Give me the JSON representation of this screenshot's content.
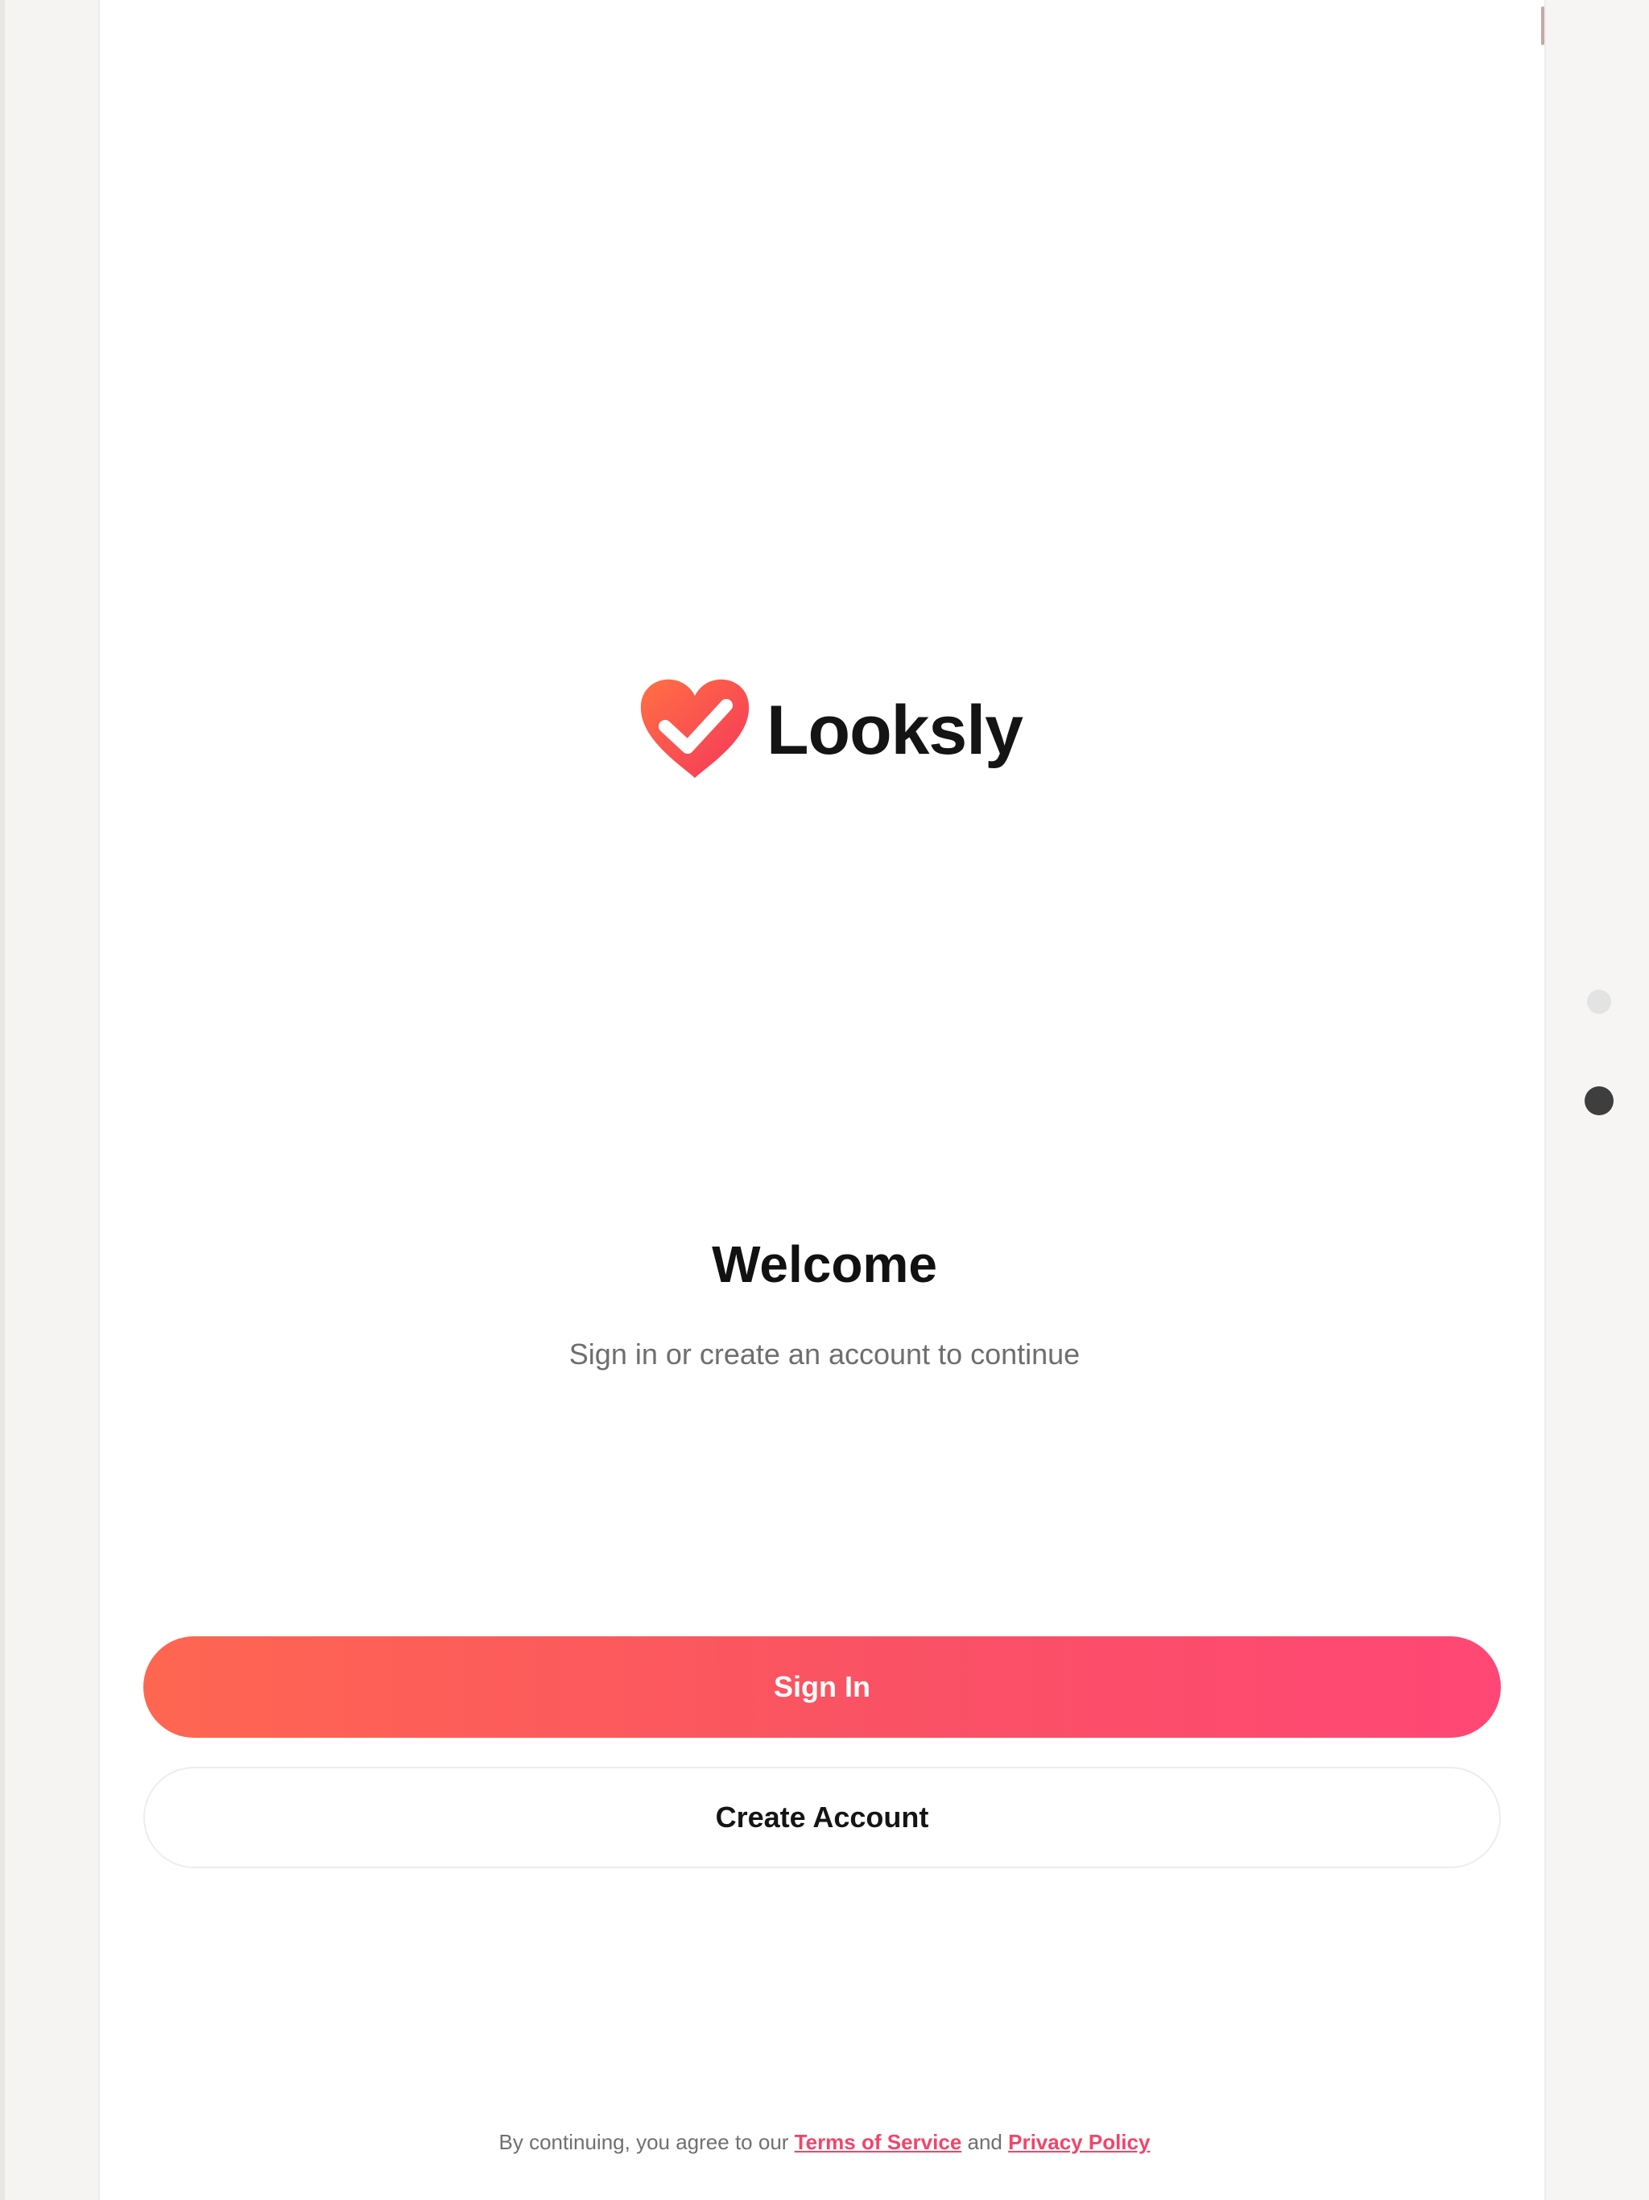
{
  "app": {
    "name": "Looksly",
    "brand_colors": {
      "gradient_start": "#ff6651",
      "gradient_end": "#ff4775",
      "link": "#f2456a"
    }
  },
  "logo": {
    "icon": "heart-check-icon",
    "text": "Looksly"
  },
  "welcome": {
    "title": "Welcome",
    "subtitle": "Sign in or create an account to continue"
  },
  "actions": {
    "sign_in_label": "Sign In",
    "create_account_label": "Create Account"
  },
  "legal": {
    "prefix": "By continuing, you agree to our ",
    "terms_label": "Terms of Service",
    "conjunction": " and ",
    "privacy_label": "Privacy Policy"
  },
  "pager": {
    "page_count": 2,
    "active_index": 1
  }
}
